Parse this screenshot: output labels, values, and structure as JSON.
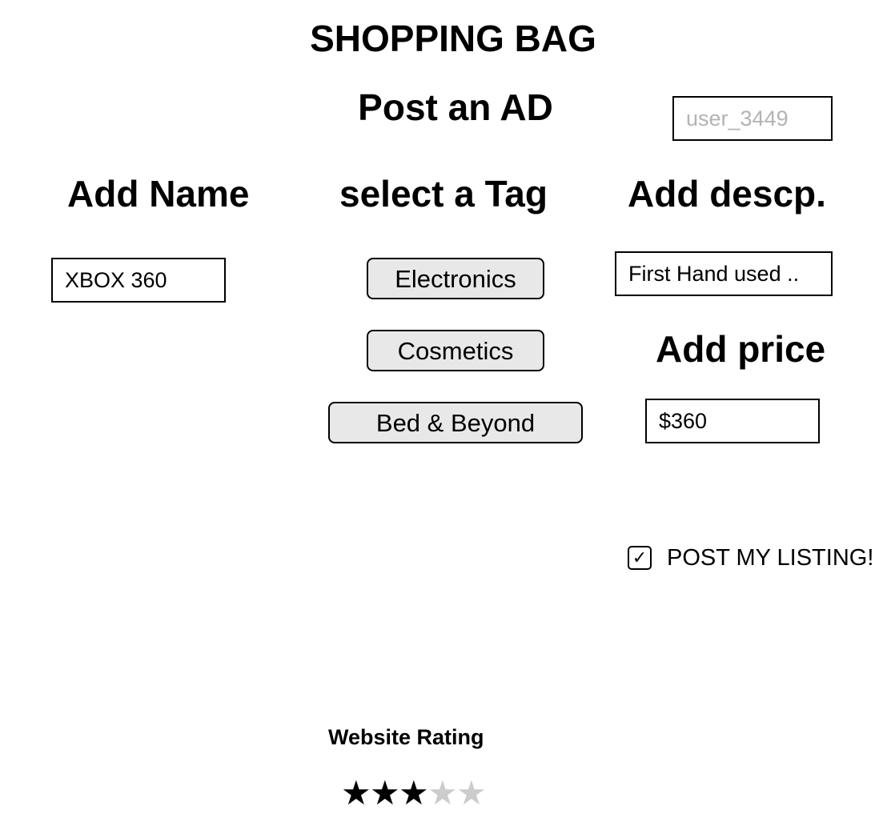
{
  "header": {
    "title": "SHOPPING BAG",
    "subtitle": "Post an AD"
  },
  "user": {
    "placeholder": "user_3449",
    "value": ""
  },
  "form": {
    "name_heading": "Add Name",
    "name_value": "XBOX 360",
    "tag_heading": "select a Tag",
    "tags": [
      "Electronics",
      "Cosmetics",
      "Bed & Beyond"
    ],
    "desc_heading": "Add descp.",
    "desc_value": "First Hand used ..",
    "price_heading": "Add price",
    "price_value": "$360",
    "post_checkbox_mark": "✓",
    "post_label": "POST MY LISTING!",
    "post_checked": true
  },
  "rating": {
    "title": "Website Rating",
    "value": 3,
    "max": 5,
    "star_glyph": "★",
    "filled_color": "#000000",
    "empty_color": "#cccccc"
  }
}
